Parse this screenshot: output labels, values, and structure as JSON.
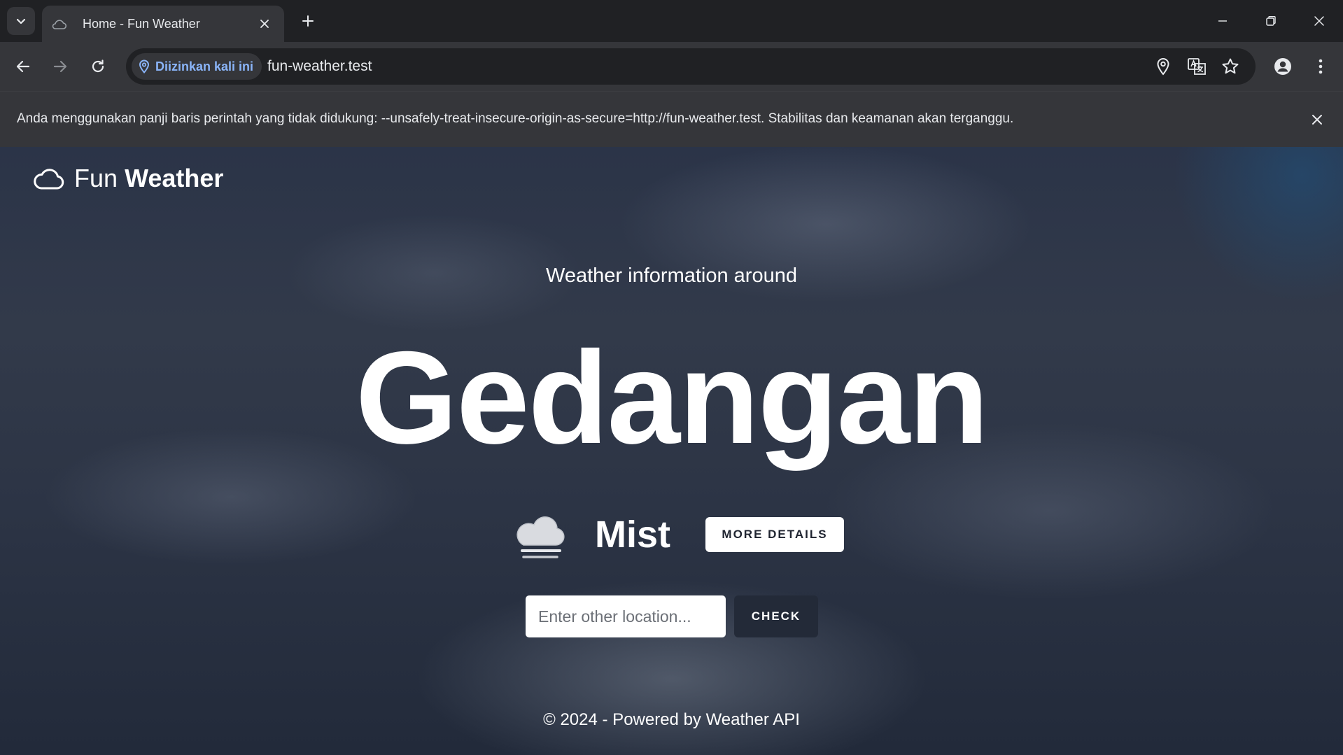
{
  "tab": {
    "title": "Home - Fun Weather",
    "favicon": "cloud-icon"
  },
  "toolbar": {
    "site_chip_label": "Diizinkan kali ini",
    "url": "fun-weather.test"
  },
  "infobar": {
    "message": "Anda menggunakan panji baris perintah yang tidak didukung: --unsafely-treat-insecure-origin-as-secure=http://fun-weather.test. Stabilitas dan keamanan akan terganggu."
  },
  "page": {
    "brand_light": "Fun",
    "brand_bold": "Weather",
    "subtitle": "Weather information around",
    "city": "Gedangan",
    "condition": "Mist",
    "more_details_label": "MORE DETAILS",
    "location_placeholder": "Enter other location...",
    "location_value": "",
    "check_label": "CHECK",
    "footer": "© 2024 - Powered by Weather API"
  },
  "colors": {
    "chrome_dark": "#202124",
    "chrome_toolbar": "#35363a",
    "chip_text": "#8ab4f8",
    "page_bg": "#2c3445",
    "check_button": "#232a38"
  }
}
